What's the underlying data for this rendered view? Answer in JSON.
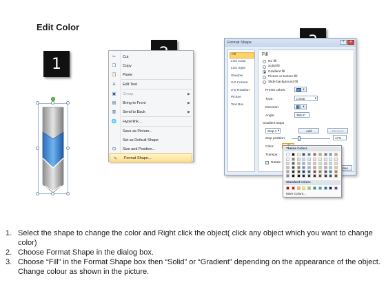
{
  "title": "Edit Color",
  "badges": [
    "1",
    "2",
    "3"
  ],
  "context_menu": {
    "items": [
      {
        "label": "Cut",
        "icon": "scissors-icon",
        "glyph": "✂",
        "submenu": false,
        "disabled": false,
        "highlighted": false
      },
      {
        "label": "Copy",
        "icon": "copy-icon",
        "glyph": "❐",
        "submenu": false,
        "disabled": false,
        "highlighted": false
      },
      {
        "label": "Paste",
        "icon": "paste-icon",
        "glyph": "📋",
        "submenu": false,
        "disabled": false,
        "highlighted": false
      },
      {
        "label": "Edit Text",
        "icon": "edit-text-icon",
        "glyph": "A",
        "submenu": false,
        "disabled": false,
        "highlighted": false
      },
      {
        "label": "Group",
        "icon": "group-icon",
        "glyph": "▣",
        "submenu": true,
        "disabled": true,
        "highlighted": false
      },
      {
        "label": "Bring to Front",
        "icon": "bring-to-front-icon",
        "glyph": "▤",
        "submenu": true,
        "disabled": false,
        "highlighted": false
      },
      {
        "label": "Send to Back",
        "icon": "send-to-back-icon",
        "glyph": "▥",
        "submenu": true,
        "disabled": false,
        "highlighted": false
      },
      {
        "label": "Hyperlink...",
        "icon": "hyperlink-icon",
        "glyph": "🌐",
        "submenu": false,
        "disabled": false,
        "highlighted": false
      },
      {
        "label": "Save as Picture...",
        "icon": "",
        "glyph": "",
        "submenu": false,
        "disabled": false,
        "highlighted": false
      },
      {
        "label": "Set as Default Shape",
        "icon": "",
        "glyph": "",
        "submenu": false,
        "disabled": false,
        "highlighted": false
      },
      {
        "label": "Size and Position...",
        "icon": "size-position-icon",
        "glyph": "⊡",
        "submenu": false,
        "disabled": false,
        "highlighted": false
      },
      {
        "label": "Format Shape...",
        "icon": "format-shape-icon",
        "glyph": "✎",
        "submenu": false,
        "disabled": false,
        "highlighted": true
      }
    ]
  },
  "dialog": {
    "title": "Format Shape",
    "nav": [
      "Fill",
      "Line Color",
      "Line Style",
      "Shadow",
      "3-D Format",
      "3-D Rotation",
      "Picture",
      "Text Box"
    ],
    "active_nav": "Fill",
    "section": "Fill",
    "fill_options": [
      {
        "label": "No fill",
        "selected": false
      },
      {
        "label": "Solid fill",
        "selected": false
      },
      {
        "label": "Gradient fill",
        "selected": true
      },
      {
        "label": "Picture or texture fill",
        "selected": false
      },
      {
        "label": "Slide background fill",
        "selected": false
      }
    ],
    "preset_colors_label": "Preset colors:",
    "type_label": "Type:",
    "type_value": "Linear",
    "direction_label": "Direction:",
    "angle_label": "Angle:",
    "angle_value": "359.9°",
    "gradient_stops_label": "Gradient stops",
    "stop_value": "Stop 1",
    "add_label": "Add",
    "remove_label": "Remove",
    "stop_position_label": "Stop position:",
    "stop_position_value": "17%",
    "color_label": "Color:",
    "transparency_label": "Transpa",
    "rotate_label": "Rotate",
    "close_label": "Close"
  },
  "palette": {
    "theme_label": "Theme Colors",
    "standard_label": "Standard Colors",
    "more_label": "More Colors...",
    "theme_top_row": [
      "#ffffff",
      "#000000",
      "#eeece1",
      "#1f497d",
      "#4f81bd",
      "#c0504d",
      "#9bbb59",
      "#8064a2",
      "#4bacc6",
      "#f79646"
    ],
    "theme_columns": [
      [
        "#f2f2f2",
        "#d9d9d9",
        "#bfbfbf",
        "#a6a6a6",
        "#808080"
      ],
      [
        "#7f7f7f",
        "#595959",
        "#404040",
        "#262626",
        "#0d0d0d"
      ],
      [
        "#ddd9c3",
        "#c4bd97",
        "#938953",
        "#494429",
        "#1d1b10"
      ],
      [
        "#c6d9f0",
        "#8db3e2",
        "#548dd4",
        "#17365d",
        "#0f243e"
      ],
      [
        "#dbe5f1",
        "#b8cce4",
        "#95b3d7",
        "#366092",
        "#244061"
      ],
      [
        "#f2dcdb",
        "#e5b9b7",
        "#d99694",
        "#953734",
        "#632423"
      ],
      [
        "#ebf1dd",
        "#d7e3bc",
        "#c3d69b",
        "#76923c",
        "#4f6128"
      ],
      [
        "#e5e0ec",
        "#ccc1d9",
        "#b2a2c7",
        "#5f497a",
        "#3f3151"
      ],
      [
        "#dbeef3",
        "#b7dde8",
        "#92cddc",
        "#31859b",
        "#205867"
      ],
      [
        "#fdeada",
        "#fbd5b5",
        "#fac08f",
        "#e36c09",
        "#974806"
      ]
    ],
    "standard_row": [
      "#c00000",
      "#ff0000",
      "#ffc000",
      "#ffff00",
      "#92d050",
      "#00b050",
      "#00b0f0",
      "#0070c0",
      "#002060",
      "#7030a0"
    ]
  },
  "instructions": [
    {
      "num": "1.",
      "text": "Select the shape to change the color and Right click the object( click any object which you want to change color)"
    },
    {
      "num": "2.",
      "text": "Choose Format Shape in the dialog box."
    },
    {
      "num": "3.",
      "text": "Choose “Fill” in the Format Shape box then “Solid” or “Gradient” depending on the appearance of the object. Change colour as shown in the picture."
    }
  ]
}
